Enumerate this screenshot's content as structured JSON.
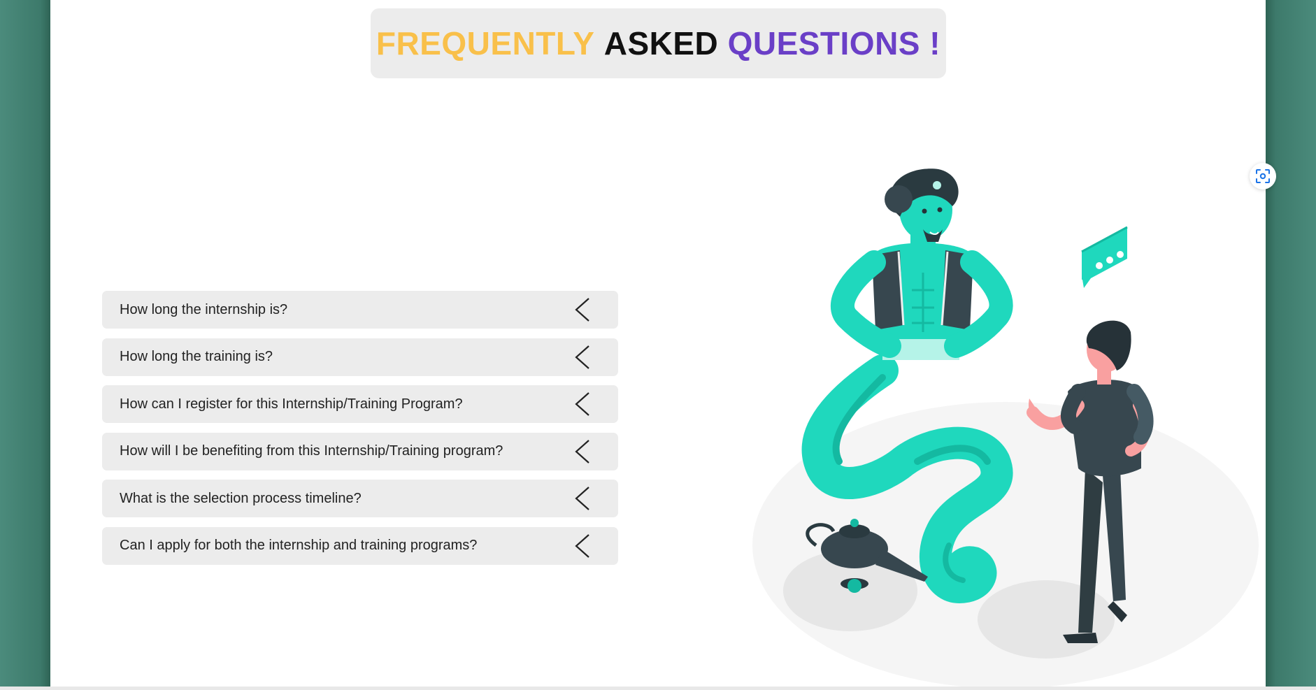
{
  "title": {
    "word1": "FREQUENTLY",
    "word2": "ASKED",
    "word3": "QUESTIONS !",
    "colors": {
      "word1": "#f9c04a",
      "word2": "#111111",
      "word3": "#6a3fc7"
    }
  },
  "faq": {
    "items": [
      {
        "question": "How long the internship is?"
      },
      {
        "question": "How long the training is?"
      },
      {
        "question": "How can I register for this Internship/Training Program?"
      },
      {
        "question": "How will I be benefiting from this Internship/Training program?"
      },
      {
        "question": "What is the selection process timeline?"
      },
      {
        "question": "Can I apply for both the internship and training programs?"
      }
    ],
    "expand_icon": "chevron-left-icon"
  },
  "illustration": {
    "subject": "genie-and-man-illustration",
    "colors": {
      "genie": "#1fd8bd",
      "dark": "#37474f",
      "skin": "#f9a0a0"
    }
  },
  "scan_icon": "visual-search-icon"
}
